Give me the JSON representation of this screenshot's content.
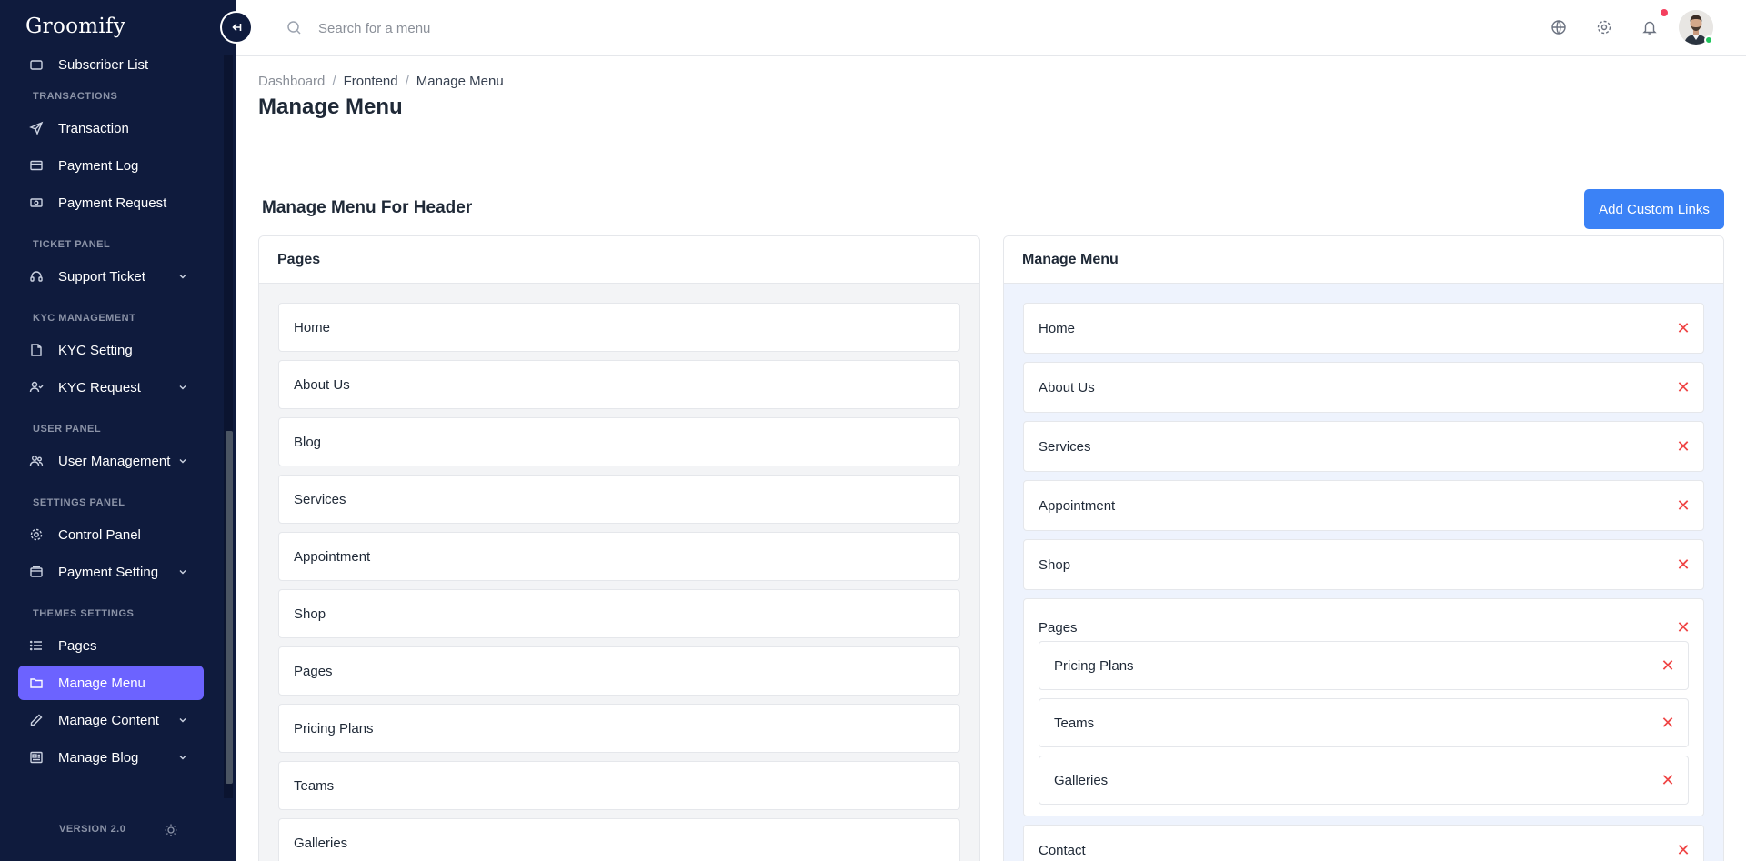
{
  "brand": {
    "name": "Groomify"
  },
  "sidebar": {
    "partial_item": "Subscriber List",
    "sections": [
      {
        "title": "TRANSACTIONS"
      },
      {
        "title": "TICKET PANEL"
      },
      {
        "title": "KYC MANAGEMENT"
      },
      {
        "title": "USER PANEL"
      },
      {
        "title": "SETTINGS PANEL"
      },
      {
        "title": "THEMES SETTINGS"
      }
    ],
    "items": [
      {
        "label": "Transaction",
        "icon": "send-icon"
      },
      {
        "label": "Payment Log",
        "icon": "card-icon"
      },
      {
        "label": "Payment Request",
        "icon": "cash-icon"
      },
      {
        "label": "Support Ticket",
        "icon": "headset-icon"
      },
      {
        "label": "KYC Setting",
        "icon": "document-icon"
      },
      {
        "label": "KYC Request",
        "icon": "user-check-icon"
      },
      {
        "label": "User Management",
        "icon": "users-icon"
      },
      {
        "label": "Control Panel",
        "icon": "gear-icon"
      },
      {
        "label": "Payment Setting",
        "icon": "wallet-icon"
      },
      {
        "label": "Pages",
        "icon": "list-icon"
      },
      {
        "label": "Manage Menu",
        "icon": "folder-icon",
        "active": true
      },
      {
        "label": "Manage Content",
        "icon": "pencil-icon"
      },
      {
        "label": "Manage Blog",
        "icon": "newspaper-icon"
      }
    ],
    "version": "VERSION 2.0",
    "active_color": "#6c63ff",
    "bg_color": "#0f1b3d"
  },
  "search": {
    "placeholder": "Search for a menu"
  },
  "breadcrumb": {
    "home": "Dashboard",
    "section": "Frontend",
    "current": "Manage Menu",
    "sep": "/"
  },
  "page": {
    "title": "Manage Menu",
    "section_heading": "Manage Menu For Header",
    "add_button": "Add Custom Links",
    "accent_color": "#3b82f6"
  },
  "pages_panel": {
    "title": "Pages",
    "items": [
      "Home",
      "About Us",
      "Blog",
      "Services",
      "Appointment",
      "Shop",
      "Pages",
      "Pricing Plans",
      "Teams",
      "Galleries"
    ]
  },
  "menu_panel": {
    "title": "Manage Menu",
    "remove_symbol": "✕",
    "items": [
      "Home",
      "About Us",
      "Services",
      "Appointment",
      "Shop"
    ],
    "parent": {
      "label": "Pages",
      "children": [
        "Pricing Plans",
        "Teams",
        "Galleries"
      ]
    },
    "after": [
      "Contact"
    ]
  }
}
